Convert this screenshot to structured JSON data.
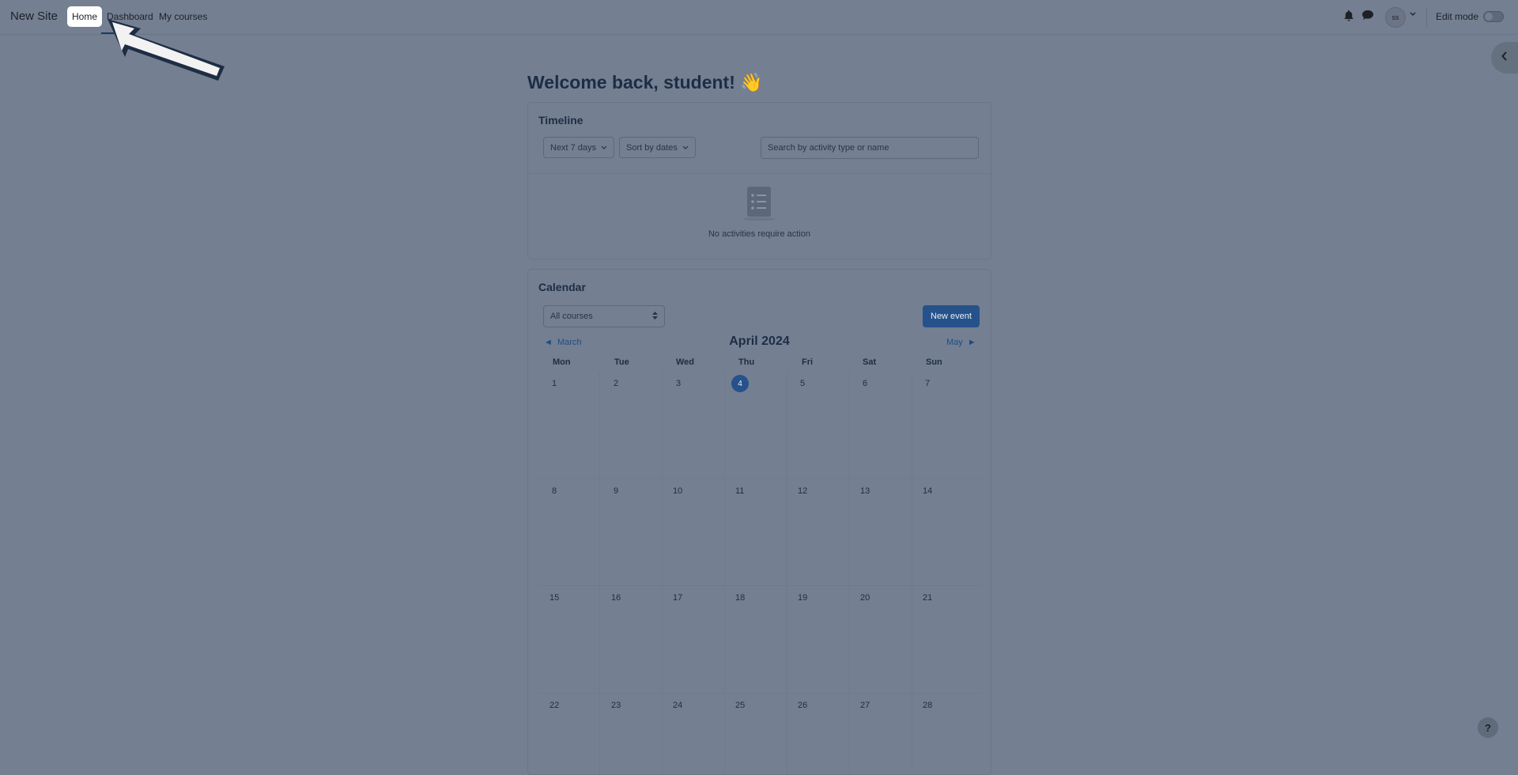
{
  "navbar": {
    "brand": "New Site",
    "links": [
      "Home",
      "Dashboard",
      "My courses"
    ],
    "avatar_initials": "ss",
    "edit_mode_label": "Edit mode",
    "edit_mode_on": false
  },
  "icons": {
    "bell": "bell-icon",
    "messages": "chat-icon",
    "chevron": "chevron-down-icon",
    "drawer": "chevron-left-icon",
    "help": "?"
  },
  "welcome": "Welcome back, student! 👋",
  "timeline": {
    "title": "Timeline",
    "filter_days": "Next 7 days",
    "sort": "Sort by dates",
    "search_placeholder": "Search by activity type or name",
    "empty_message": "No activities require action"
  },
  "calendar": {
    "title": "Calendar",
    "course_filter": "All courses",
    "new_event_label": "New event",
    "prev_month": "March",
    "next_month": "May",
    "month_title": "April 2024",
    "weekdays": [
      "Mon",
      "Tue",
      "Wed",
      "Thu",
      "Fri",
      "Sat",
      "Sun"
    ],
    "weeks": [
      [
        "1",
        "2",
        "3",
        "4",
        "5",
        "6",
        "7"
      ],
      [
        "8",
        "9",
        "10",
        "11",
        "12",
        "13",
        "14"
      ],
      [
        "15",
        "16",
        "17",
        "18",
        "19",
        "20",
        "21"
      ],
      [
        "22",
        "23",
        "24",
        "25",
        "26",
        "27",
        "28"
      ]
    ],
    "today": "4"
  },
  "colors": {
    "overlay_background": "#747f92",
    "primary": "#25528a",
    "text": "#1d2d44"
  }
}
